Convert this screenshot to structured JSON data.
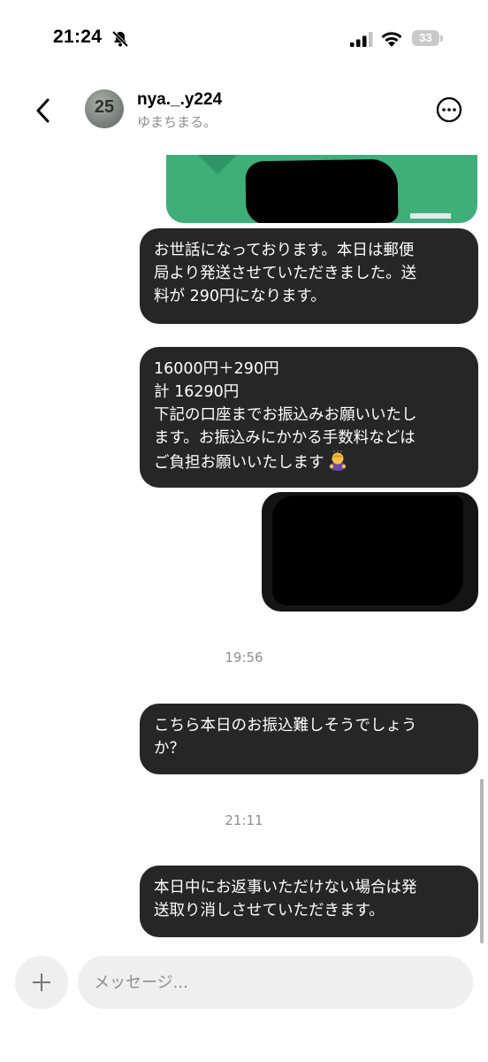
{
  "status_bar": {
    "time": "21:24",
    "battery": "33"
  },
  "header": {
    "avatar_text": "25",
    "username": "nya._.y224",
    "subtitle": "ゆまちまる。"
  },
  "messages": [
    {
      "lines": [
        "お世話になっております。本日は郵便",
        "局より発送させていただきました。送",
        "料が 290円になります。"
      ]
    },
    {
      "lines": [
        "16000円＋290円",
        "計 16290円",
        "下記の口座までお振込みお願いいたし",
        "ます。お振込みにかかる手数料などは",
        "ご負担お願いいたします"
      ]
    },
    {
      "lines": [
        "こちら本日のお振込難しそうでしょう",
        "か？"
      ]
    },
    {
      "lines": [
        "本日中にお返事いただけない場合は発",
        "送取り消しさせていただきます。"
      ]
    }
  ],
  "timestamps": [
    "19:56",
    "21:11"
  ],
  "composer": {
    "placeholder": "メッセージ..."
  },
  "colors": {
    "bubble": "#262626",
    "image_green": "#3fae79"
  },
  "icons": [
    "bell-slash-icon",
    "signal-icon",
    "wifi-icon",
    "battery-icon",
    "back-icon",
    "more-icon",
    "plus-icon",
    "bowing-person-emoji"
  ]
}
